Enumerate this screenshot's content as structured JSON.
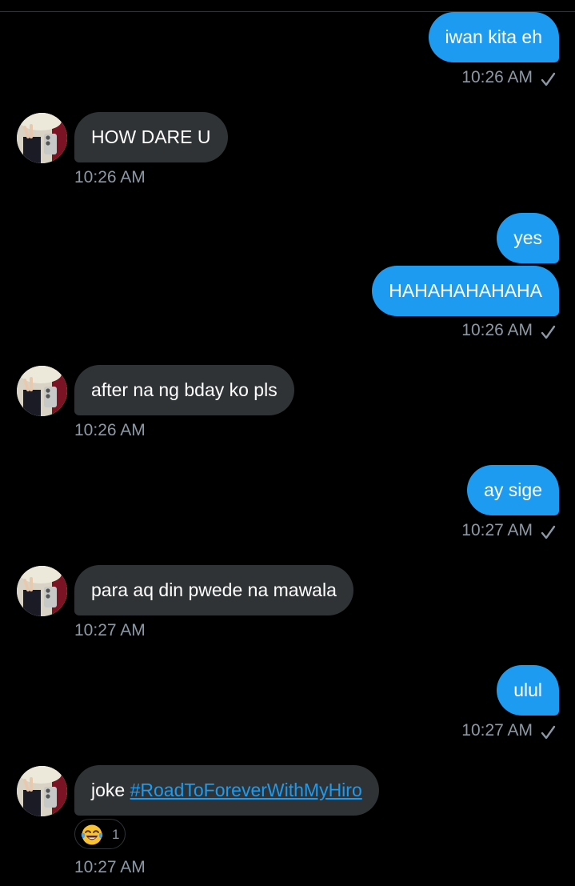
{
  "conversation": {
    "messages": [
      {
        "direction": "outgoing",
        "text": "iwan kita eh"
      },
      {
        "direction": "incoming",
        "text": "HOW DARE U",
        "time": "10:26 AM"
      },
      {
        "direction": "outgoing",
        "text": "yes"
      },
      {
        "direction": "outgoing",
        "text": "HAHAHAHAHAHA"
      },
      {
        "direction": "incoming",
        "text": "after na ng bday ko pls",
        "time": "10:26 AM"
      },
      {
        "direction": "outgoing",
        "text": "ay sige"
      },
      {
        "direction": "incoming",
        "text": "para aq din pwede na mawala",
        "time": "10:27 AM"
      },
      {
        "direction": "outgoing",
        "text": "ulul"
      },
      {
        "direction": "incoming",
        "text": "joke",
        "hashtag": "#RoadToForeverWithMyHiro",
        "time": "10:27 AM"
      }
    ],
    "outgoing_times": [
      "10:26 AM",
      "10:26 AM",
      "10:27 AM",
      "10:27 AM"
    ],
    "reaction": {
      "emoji": "face-with-tears-of-joy",
      "count": "1"
    }
  },
  "colors": {
    "background": "#000000",
    "outgoing_bubble": "#1d9bf0",
    "incoming_bubble": "#2f3336",
    "timestamp": "#8b98a5",
    "link": "#1d9bf0"
  },
  "icons": {
    "read_receipt": "check-icon",
    "avatar": "avatar-photo"
  }
}
